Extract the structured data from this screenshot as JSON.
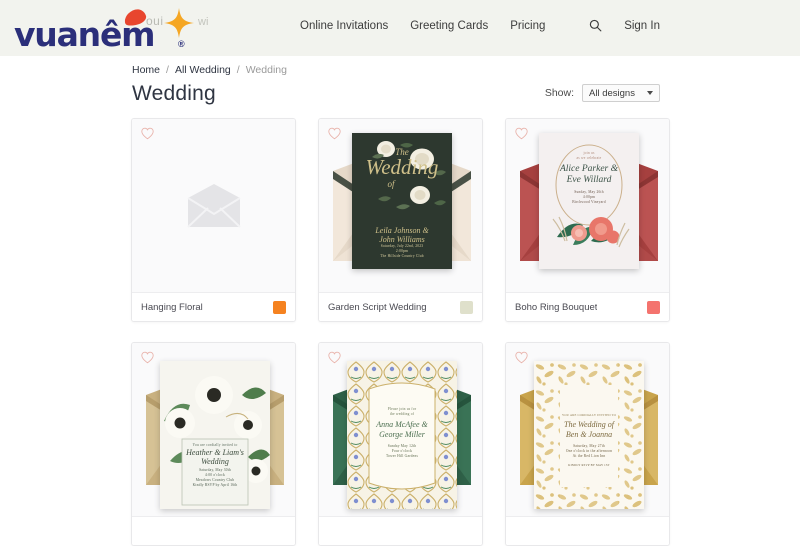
{
  "brand": {
    "logo_text": "vuanêm",
    "logo_registered": "®",
    "ghost_text_1": "oui",
    "ghost_text_2": "wi",
    "logo_color": "#2b2f7a",
    "logo_accent": "#e8462e",
    "logo_star_color": "#f5a623"
  },
  "header": {
    "background": "#f2f3ee",
    "nav": [
      {
        "label": "Online Invitations"
      },
      {
        "label": "Greeting Cards"
      },
      {
        "label": "Pricing"
      }
    ],
    "search_icon": "search-icon",
    "signin_label": "Sign In"
  },
  "breadcrumb": {
    "items": [
      {
        "label": "Home",
        "current": false
      },
      {
        "label": "All Wedding",
        "current": false
      },
      {
        "label": "Wedding",
        "current": true
      }
    ],
    "separator": "/"
  },
  "main": {
    "title": "Wedding",
    "show_label": "Show:",
    "show_selected": "All designs",
    "show_options": [
      "All designs"
    ]
  },
  "cards": [
    {
      "name": "Hanging Floral",
      "swatch": "#f58220",
      "art": "placeholder-envelope",
      "envelope_color": "#e2e2e4",
      "favorite": false
    },
    {
      "name": "Garden Script Wedding",
      "swatch": "#dfe0cb",
      "art": "garden-script",
      "envelope_color": "#ede0d2",
      "invite_bg": "#2d382f",
      "invite_lines": [
        "The",
        "Wedding",
        "of",
        "Leila Johnson &",
        "John Williams",
        "Saturday, July 22nd, 2023",
        "2:00pm",
        "The Hillside Country Club"
      ],
      "favorite": false
    },
    {
      "name": "Boho Ring Bouquet",
      "swatch": "#f4736e",
      "art": "boho-ring",
      "envelope_color": "#b34a4a",
      "invite_bg": "#f4f0f0",
      "invite_lines": [
        "join us",
        "as we celebrate",
        "Alice Parker &",
        "Eve Willard",
        "Sunday, May 26th",
        "4:00pm",
        "Birchwood Vineyard"
      ],
      "favorite": false
    },
    {
      "name": "",
      "swatch": "",
      "art": "anemone-gold",
      "envelope_color": "#c9b180",
      "invite_bg": "#f6f5ef",
      "invite_lines": [
        "You are cordially invited to",
        "Heather & Liam's",
        "Wedding",
        "Saturday, May 30th",
        "4:00 o'clock",
        "Meadows Country Club",
        "Kindly RSVP by April 16th"
      ],
      "favorite": false
    },
    {
      "name": "",
      "swatch": "",
      "art": "ornate-green",
      "envelope_color": "#2f6148",
      "invite_bg": "#f7f3e6",
      "invite_lines": [
        "Please join us for",
        "the wedding of",
        "Anna McAfee &",
        "George Miller",
        "Sunday May 12th",
        "Four o'clock",
        "Tower Hill Gardens"
      ],
      "favorite": false
    },
    {
      "name": "",
      "swatch": "",
      "art": "gold-floral",
      "envelope_color": "#c9a44c",
      "invite_bg": "#fbf8f0",
      "invite_lines": [
        "YOU ARE CORDIALLY INVITED TO",
        "The Wedding of",
        "Ben & Joanna",
        "Saturday, May 27th",
        "One o'clock in the afternoon",
        "At the Red Lion Inn",
        "KINDLY RSVP BY MAY 1ST"
      ],
      "favorite": false
    }
  ]
}
